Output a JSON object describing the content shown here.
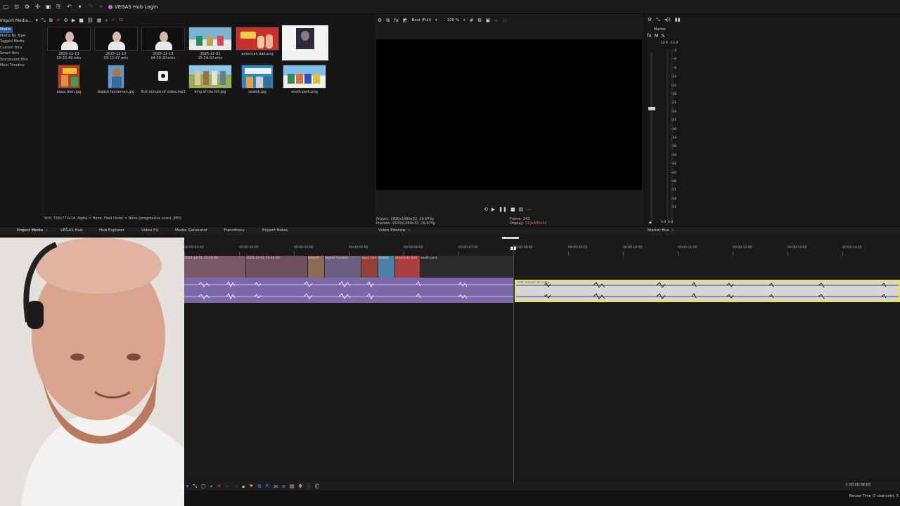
{
  "topbar": {
    "hub_login": "VEGAS Hub Login",
    "icons": [
      "new-icon",
      "open-icon",
      "settings-icon",
      "gear-icon",
      "save-icon",
      "render-icon",
      "undo-icon",
      "dropdown-icon",
      "redo-icon",
      "dropdown-icon"
    ]
  },
  "media": {
    "import_label": "Import Media...",
    "tree": [
      "Media",
      "Media By Type",
      "Tagged Media",
      "Custom Bins",
      "Smart Bins",
      "Storyboard Bins",
      "Main Timeline"
    ],
    "thumbs": [
      {
        "cap1": "2025-11-13",
        "cap2": "00-30-49.mkv"
      },
      {
        "cap1": "2025-11-13",
        "cap2": "03-13-47.mkv"
      },
      {
        "cap1": "2025-11-13",
        "cap2": "04-50-20.mkv"
      },
      {
        "cap1": "2025-12-01",
        "cap2": "15-24-50.mkv"
      },
      {
        "cap1": "american dad.png",
        "cap2": ""
      },
      {
        "cap1": "",
        "cap2": ""
      },
      {
        "cap1": "aqua teen.jpg",
        "cap2": ""
      },
      {
        "cap1": "bojack horseman.jpg",
        "cap2": ""
      },
      {
        "cap1": "first minute of video.mp3",
        "cap2": ""
      },
      {
        "cap1": "king of the hill.jpg",
        "cap2": ""
      },
      {
        "cap1": "sealab.jpg",
        "cap2": ""
      },
      {
        "cap1": "south park.png",
        "cap2": ""
      }
    ],
    "status": "Still: 736x772x24, Alpha = None, Field Order = None (progressive scan), JPEG"
  },
  "tabs": [
    {
      "label": "Project Media",
      "x": "⨯"
    },
    {
      "label": "VEGAS Hub",
      "x": ""
    },
    {
      "label": "Hub Explorer",
      "x": ""
    },
    {
      "label": "Video FX",
      "x": ""
    },
    {
      "label": "Media Generator",
      "x": ""
    },
    {
      "label": "Transitions",
      "x": ""
    },
    {
      "label": "Project Notes",
      "x": ""
    },
    {
      "label": "Video Preview",
      "x": "⨯"
    },
    {
      "label": "Master Bus",
      "x": "⨯"
    }
  ],
  "preview": {
    "quality": "Best (Full)",
    "zoom": "100 %",
    "project_label": "Project:",
    "project_value": "1920x1080x32, 29.970p",
    "preview_label": "Preview:",
    "preview_value": "1920x1080x32, 29.970p",
    "frame_label": "Frame:",
    "frame_value": "243",
    "display_label": "Display:",
    "display_value": "720x405x32"
  },
  "master": {
    "label": "Master",
    "fx": "fx",
    "m": "M",
    "s": "S",
    "top_left": "-12.9",
    "top_right": "-12.9",
    "bottom_left": "0.0",
    "bottom_right": "0.0",
    "scale": [
      "3",
      "6",
      "9",
      "12",
      "15",
      "18",
      "21",
      "24",
      "27",
      "30",
      "33",
      "36",
      "39",
      "42",
      "45",
      "48",
      "51",
      "54",
      "57"
    ]
  },
  "timeline": {
    "ticks": [
      "00:00:02:00",
      "00:00:03:00",
      "00:00:04:00",
      "00:00:05:00",
      "00:00:06:00",
      "00:00:07:00",
      "00:00:08:00",
      "00:00:09:00",
      "00:00:10:00",
      "00:00:11:00",
      "00:00:12:00",
      "00:00:13:00",
      "00:00:14:00"
    ],
    "video_labels": [
      "2025-12-01 15-24-50",
      "2025-12-01 15-24-50",
      "king of",
      "bojack horsem",
      "aqua teen",
      "sealab",
      "american dad",
      "south park"
    ],
    "audio2_label": "first minute of video",
    "time": "00:00:08:03",
    "record_time": "Record Time (2 channels): 5"
  },
  "colors": {
    "audio_selected_border": "#e5ea3c",
    "video_track": "#6a4a5a",
    "audio_track": "#7b68a8"
  }
}
